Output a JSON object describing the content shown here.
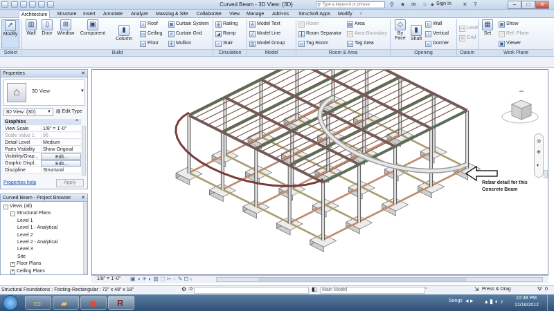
{
  "window": {
    "title": "Curved Beam - 3D View: {3D}",
    "search_placeholder": "Type a keyword or phrase",
    "sign_in": "Sign In"
  },
  "tabs": [
    "Architecture",
    "Structure",
    "Insert",
    "Annotate",
    "Analyze",
    "Massing & Site",
    "Collaborate",
    "View",
    "Manage",
    "Add-Ins",
    "StrucSoft Apps",
    "Modify"
  ],
  "ribbon": {
    "modify": "Modify",
    "select_panel": "Select",
    "build": {
      "wall": "Wall",
      "door": "Door",
      "window": "Window",
      "component": "Component",
      "column": "Column",
      "roof": "Roof",
      "ceiling": "Ceiling",
      "floor": "Floor",
      "curtain_system": "Curtain System",
      "curtain_grid": "Curtain Grid",
      "mullion": "Mullion",
      "panel": "Build"
    },
    "circulation": {
      "railing": "Railing",
      "ramp": "Ramp",
      "stair": "Stair",
      "panel": "Circulation"
    },
    "model": {
      "model_text": "Model Text",
      "model_line": "Model Line",
      "model_group": "Model Group",
      "panel": "Model"
    },
    "room_area": {
      "room": "Room",
      "room_separator": "Room Separator",
      "tag_room": "Tag Room",
      "area": "Area",
      "area_boundary": "Area Boundary",
      "tag_area": "Tag Area",
      "panel": "Room & Area"
    },
    "opening": {
      "by_face": "By Face",
      "shaft": "Shaft",
      "wall": "Wall",
      "vertical": "Vertical",
      "dormer": "Dormer",
      "panel": "Opening"
    },
    "datum": {
      "level": "Level",
      "grid": "Grid",
      "panel": "Datum"
    },
    "work_plane": {
      "set": "Set",
      "show": "Show",
      "ref_plane": "Ref. Plane",
      "viewer": "Viewer",
      "panel": "Work Plane"
    }
  },
  "properties": {
    "title": "Properties",
    "type_name": "3D View",
    "selector": "3D View: {3D}",
    "edit_type": "Edit Type",
    "section": "Graphics",
    "rows": [
      {
        "name": "View Scale",
        "value": "1/8\" = 1'-0\""
      },
      {
        "name": "Scale Value   1:",
        "value": "96"
      },
      {
        "name": "Detail Level",
        "value": "Medium"
      },
      {
        "name": "Parts Visibility",
        "value": "Show Original"
      },
      {
        "name": "Visibility/Grap...",
        "value": "Edit..."
      },
      {
        "name": "Graphic Displ...",
        "value": "Edit..."
      },
      {
        "name": "Discipline",
        "value": "Structural"
      }
    ],
    "help": "Properties help",
    "apply": "Apply"
  },
  "browser": {
    "title": "Curved Beam - Project Browser",
    "nodes": [
      {
        "label": "Views (all)",
        "level": 0,
        "exp": "-"
      },
      {
        "label": "Structural Plans",
        "level": 1,
        "exp": "-"
      },
      {
        "label": "Level 1",
        "level": 2,
        "exp": ""
      },
      {
        "label": "Level 1 - Analytical",
        "level": 2,
        "exp": ""
      },
      {
        "label": "Level 2",
        "level": 2,
        "exp": ""
      },
      {
        "label": "Level 2 - Analytical",
        "level": 2,
        "exp": ""
      },
      {
        "label": "Level 3",
        "level": 2,
        "exp": ""
      },
      {
        "label": "Site",
        "level": 2,
        "exp": ""
      },
      {
        "label": "Floor Plans",
        "level": 1,
        "exp": "+"
      },
      {
        "label": "Ceiling Plans",
        "level": 1,
        "exp": "+"
      }
    ]
  },
  "viewport": {
    "annotation_line1": "Rebar detail for this",
    "annotation_line2": "Concrete Beam"
  },
  "view_control": {
    "scale": "1/8\" = 1'-0\""
  },
  "status": {
    "message": "Structural Foundations : Footing-Rectangular : 72\" x 48\" x 18\"",
    "zero": ":0",
    "model": "Main Model",
    "press_drag": "Press & Drag",
    "filter": "0"
  },
  "taskbar": {
    "songs": "Songs",
    "time": "10:38 PM",
    "date": "12/16/2012"
  },
  "colors": {
    "ribbon_bg": "#e3ebf6",
    "rebar_red": "#b03030",
    "rebar_green": "#2f8a2f",
    "taskbar": "#2f4f73"
  }
}
